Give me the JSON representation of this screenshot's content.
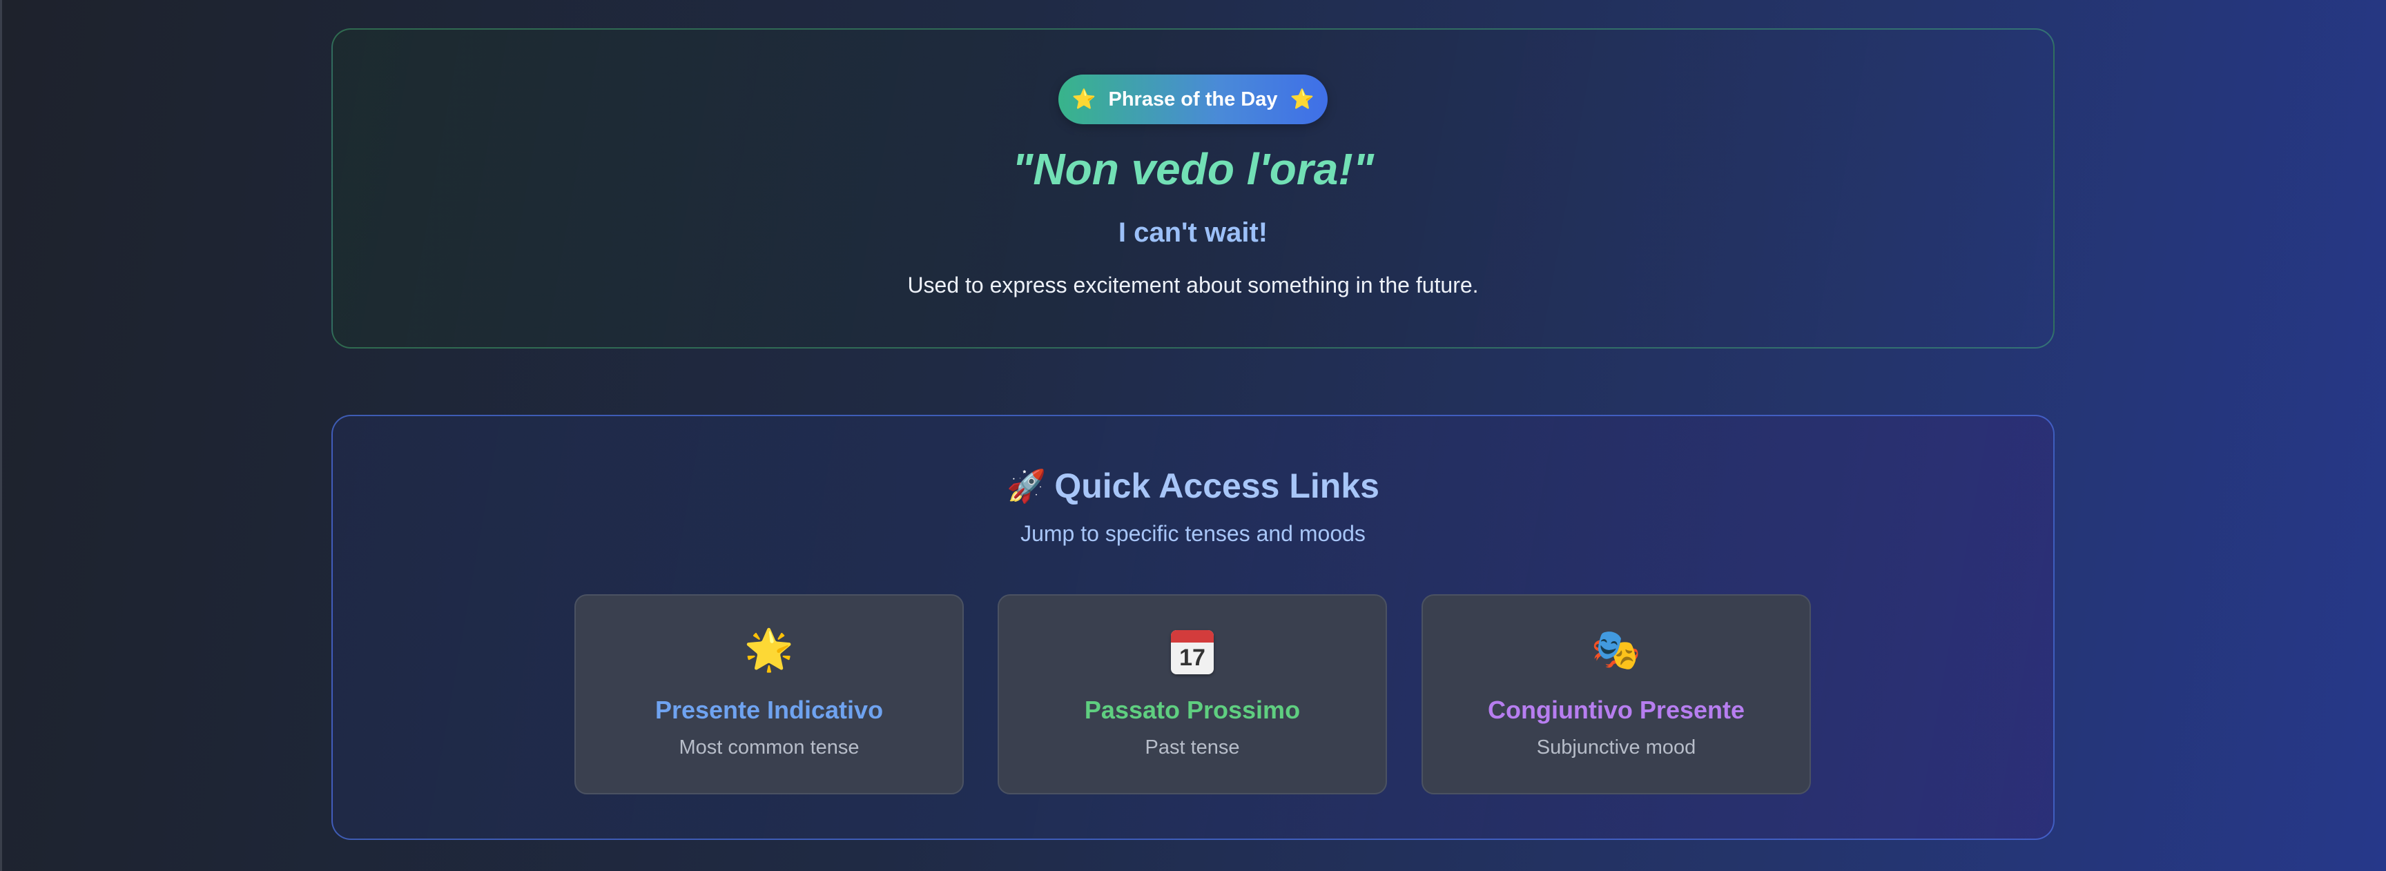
{
  "phrase_of_day": {
    "badge_label": "Phrase of the Day",
    "badge_icon": "star-icon",
    "italian": "\"Non vedo l'ora!\"",
    "english": "I can't wait!",
    "description": "Used to express excitement about something in the future."
  },
  "quick_access": {
    "icon": "rocket-icon",
    "title": "Quick Access Links",
    "subtitle": "Jump to specific tenses and moods",
    "links": [
      {
        "icon": "glowing-star-icon",
        "title": "Presente Indicativo",
        "description": "Most common tense",
        "color": "#6fa3f0"
      },
      {
        "icon": "calendar-icon",
        "title": "Passato Prossimo",
        "description": "Past tense",
        "color": "#5fcf80",
        "calendar_day": "17"
      },
      {
        "icon": "theater-masks-icon",
        "title": "Congiuntivo Presente",
        "description": "Subjunctive mood",
        "color": "#b77ef0"
      }
    ]
  },
  "colors": {
    "phrase_accent": "#72e0b5",
    "translation": "#9cc0f8",
    "card_border_green": "#48bb78",
    "card_border_blue": "#5078f0"
  }
}
